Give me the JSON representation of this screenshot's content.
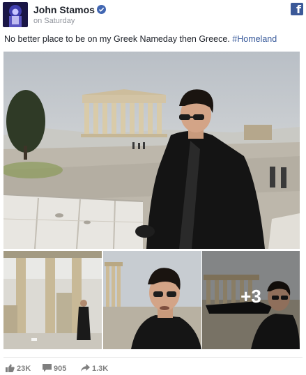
{
  "post": {
    "author": "John Stamos",
    "timestamp": "on Saturday",
    "caption_text": "No better place to be on my Greek Nameday then Greece. ",
    "hashtag": "#Homeland",
    "more_photos": "+3",
    "stats": {
      "likes": "23K",
      "comments": "905",
      "shares": "1.3K"
    }
  },
  "icons": {
    "verified": "verified-badge-icon",
    "facebook": "facebook-logo-icon",
    "like": "thumbs-up-icon",
    "comment": "comment-icon",
    "share": "share-arrow-icon"
  },
  "colors": {
    "facebook_blue": "#3b5998",
    "link_blue": "#365899",
    "verified_blue": "#4267b2",
    "meta_gray": "#90949c"
  }
}
